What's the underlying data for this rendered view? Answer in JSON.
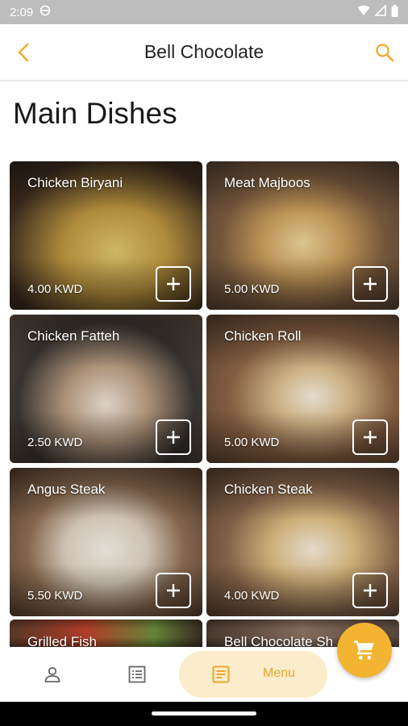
{
  "status": {
    "time": "2:09"
  },
  "header": {
    "title": "Bell Chocolate"
  },
  "section": {
    "title": "Main Dishes"
  },
  "items": [
    {
      "name": "Chicken Biryani",
      "price": "4.00 KWD",
      "color": "#9c7a3c"
    },
    {
      "name": "Meat Majboos",
      "price": "5.00 KWD",
      "color": "#a88a5a"
    },
    {
      "name": "Chicken Fatteh",
      "price": "2.50 KWD",
      "color": "#6d5848"
    },
    {
      "name": "Chicken Roll",
      "price": "5.00 KWD",
      "color": "#7a5a3e"
    },
    {
      "name": "Angus Steak",
      "price": "5.50 KWD",
      "color": "#6e5340"
    },
    {
      "name": "Chicken Steak",
      "price": "4.00 KWD",
      "color": "#6a5140"
    },
    {
      "name": "Grilled Fish",
      "price": "",
      "color": "#7a3a2a"
    },
    {
      "name": "Bell Chocolate Sh",
      "price": "",
      "color": "#6a5444"
    }
  ],
  "nav": {
    "menu_label": "Menu"
  },
  "colors": {
    "accent": "#f3b431",
    "accent_light": "#fbeccb"
  }
}
